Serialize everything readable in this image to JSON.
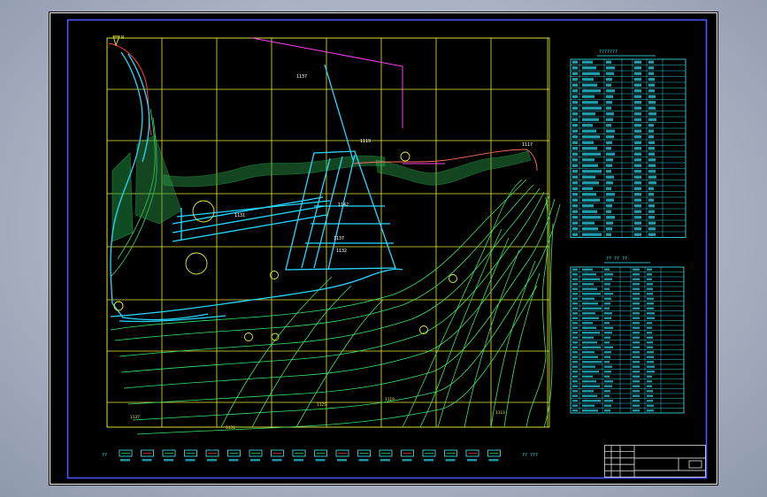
{
  "sheet": {
    "background": "#000000",
    "frame_color": "#4a55ff",
    "grid_color": "#e8ec3a",
    "contour_color": "#39e66a",
    "structure_color": "#26d8ff",
    "profile_color": "#ff3df2",
    "table_color": "#39f0ff"
  },
  "plan": {
    "callouts": [
      "1137",
      "1119",
      "1142",
      "1137",
      "1132",
      "1131",
      "1117"
    ],
    "elevations": [
      "1137",
      "1131",
      "1125",
      "1119",
      "1113"
    ]
  },
  "table1": {
    "title": "???????"
  },
  "table2": {
    "title": "?? ?? ??"
  },
  "legend": {
    "lead_label": "??",
    "item_count": 18,
    "end_label": "??  ???"
  },
  "title_block": {
    "rows": 5
  },
  "icons": [
    "north-arrow-icon",
    "legend-swatch-icon"
  ]
}
